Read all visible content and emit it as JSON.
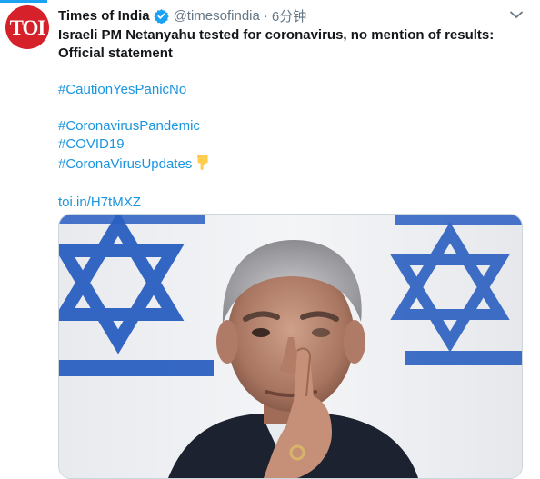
{
  "account": {
    "avatar_text": "TOI",
    "display_name": "Times of India",
    "handle": "@timesofindia",
    "separator": "·",
    "time": "6分钟",
    "verified": true
  },
  "tweet": {
    "headline": "Israeli PM Netanyahu tested for coronavirus, no mention of results: Official statement",
    "hashtags_group1": [
      "#CautionYesPanicNo"
    ],
    "hashtags_group2": [
      "#CoronavirusPandemic",
      "#COVID19",
      "#CoronaVirusUpdates"
    ],
    "emoji": "backhand-index-pointing-down",
    "link": "toi.in/H7tMXZ"
  },
  "media": {
    "subject": "photo of a man rubbing his eye in front of Israeli flags"
  },
  "colors": {
    "accent": "#1da1f2",
    "link": "#1b95e0",
    "muted": "#657786",
    "avatar_bg": "#d6202a",
    "flag_blue": "#2a5fc0"
  }
}
